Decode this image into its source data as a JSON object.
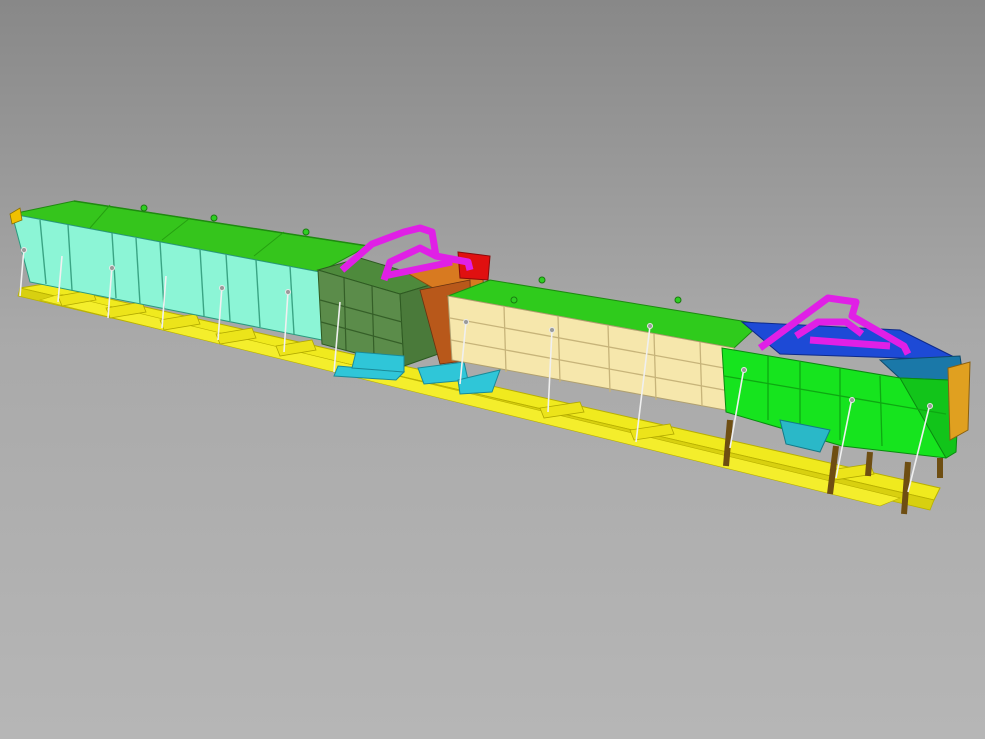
{
  "scene": {
    "background": {
      "top": "#8a8a8a",
      "mid": "#b0b0b0",
      "bottom": "#b4b4b4"
    },
    "colors": {
      "base_rail": "#f0ea1e",
      "base_rail_edge": "#c8c000",
      "section_1": "#8cf5d2",
      "section_1_top": "#33c41a",
      "section_2": "#5a8a4a",
      "section_3": "#f5e6a8",
      "section_3_top": "#2ec81a",
      "section_4": "#14e61e",
      "frame_magenta": "#e61ee6",
      "bracket_cyan": "#2ec8d8",
      "accent_red": "#e01010",
      "accent_orange": "#e07818",
      "accent_blue": "#1e4ad8",
      "leg_brown": "#8a6418",
      "turnbuckle": "#e0e0e0"
    },
    "parts": [
      "base-rail",
      "conveyor-section-1",
      "conveyor-section-2",
      "conveyor-section-3",
      "conveyor-section-4",
      "lifting-frame-1",
      "lifting-frame-2",
      "turnbuckle-braces",
      "support-legs"
    ]
  }
}
